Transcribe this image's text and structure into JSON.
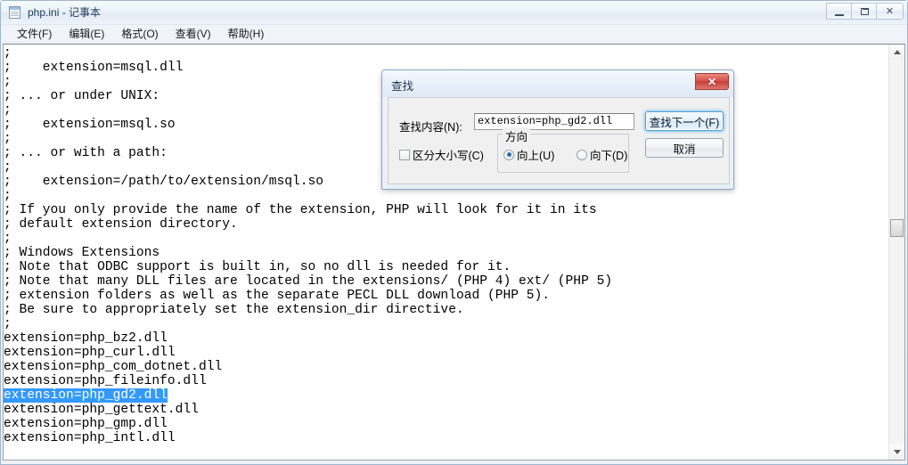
{
  "window": {
    "title": "php.ini - 记事本",
    "icon": "notepad-icon",
    "buttons": {
      "minimize": "",
      "maximize": "",
      "close": "✕"
    }
  },
  "menubar": {
    "items": [
      {
        "label": "文件(F)"
      },
      {
        "label": "编辑(E)"
      },
      {
        "label": "格式(O)"
      },
      {
        "label": "查看(V)"
      },
      {
        "label": "帮助(H)"
      }
    ]
  },
  "editor": {
    "lines": [
      {
        "text": ";",
        "selected": false
      },
      {
        "text": ";    extension=msql.dll",
        "selected": false
      },
      {
        "text": ";",
        "selected": false
      },
      {
        "text": "; ... or under UNIX:",
        "selected": false
      },
      {
        "text": ";",
        "selected": false
      },
      {
        "text": ";    extension=msql.so",
        "selected": false
      },
      {
        "text": ";",
        "selected": false
      },
      {
        "text": "; ... or with a path:",
        "selected": false
      },
      {
        "text": ";",
        "selected": false
      },
      {
        "text": ";    extension=/path/to/extension/msql.so",
        "selected": false
      },
      {
        "text": ";",
        "selected": false
      },
      {
        "text": "; If you only provide the name of the extension, PHP will look for it in its",
        "selected": false
      },
      {
        "text": "; default extension directory.",
        "selected": false
      },
      {
        "text": ";",
        "selected": false
      },
      {
        "text": "; Windows Extensions",
        "selected": false
      },
      {
        "text": "; Note that ODBC support is built in, so no dll is needed for it.",
        "selected": false
      },
      {
        "text": "; Note that many DLL files are located in the extensions/ (PHP 4) ext/ (PHP 5)",
        "selected": false
      },
      {
        "text": "; extension folders as well as the separate PECL DLL download (PHP 5).",
        "selected": false
      },
      {
        "text": "; Be sure to appropriately set the extension_dir directive.",
        "selected": false
      },
      {
        "text": ";",
        "selected": false
      },
      {
        "text": "extension=php_bz2.dll",
        "selected": false
      },
      {
        "text": "extension=php_curl.dll",
        "selected": false
      },
      {
        "text": "extension=php_com_dotnet.dll",
        "selected": false
      },
      {
        "text": "extension=php_fileinfo.dll",
        "selected": false
      },
      {
        "text": "extension=php_gd2.dll",
        "selected": true
      },
      {
        "text": "extension=php_gettext.dll",
        "selected": false
      },
      {
        "text": "extension=php_gmp.dll",
        "selected": false
      },
      {
        "text": "extension=php_intl.dll",
        "selected": false
      }
    ],
    "selection_color": "#3399ff"
  },
  "scrollbar": {
    "up_arrow": "scroll-up-arrow",
    "down_arrow": "scroll-down-arrow",
    "thumb": "scroll-thumb"
  },
  "find_dialog": {
    "title": "查找",
    "close_label": "✕",
    "find_what_label": "查找内容(N):",
    "find_what_value": "extension=php_gd2.dll",
    "find_what_placeholder": "",
    "find_next_button": "查找下一个(F)",
    "cancel_button": "取消",
    "match_case_label": "区分大小写(C)",
    "match_case_checked": false,
    "direction_legend": "方向",
    "direction_up": "向上(U)",
    "direction_down": "向下(D)",
    "direction_selected": "up"
  }
}
